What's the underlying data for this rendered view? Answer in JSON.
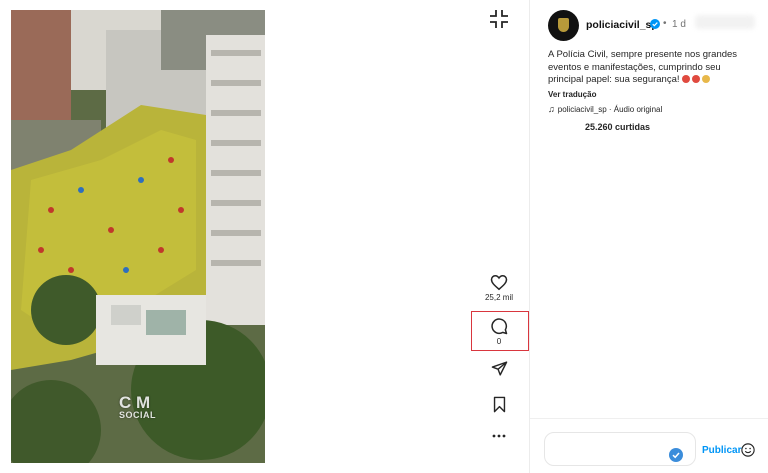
{
  "post": {
    "username": "policiacivil_sp",
    "time": "1 d",
    "dot": "•",
    "caption": "A Polícia Civil, sempre presente nos grandes eventos e manifestações, cumprindo seu principal papel: sua segurança!",
    "translate_label": "Ver tradução",
    "audio_label": "policiacivil_sp · Áudio original",
    "likes_label": "25.260 curtidas"
  },
  "video": {
    "watermark_main": "C M",
    "watermark_sub": "SOCIAL"
  },
  "actions": {
    "like_count": "25,2 mil",
    "comment_count": "0"
  },
  "comment": {
    "placeholder": "",
    "publish_label": "Publicar"
  },
  "colors": {
    "accent": "#0095f6",
    "highlight": "#d9363e",
    "verified": "#0095f6"
  }
}
